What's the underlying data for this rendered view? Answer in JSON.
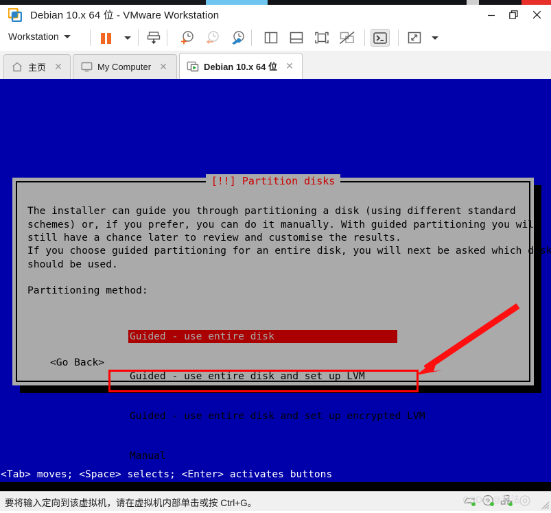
{
  "window": {
    "title": "Debian 10.x 64 位 - VMware Workstation",
    "logo_icon": "vmware-logo-icon",
    "minimize_label": "—",
    "maximize_label": "❐",
    "close_label": "✕"
  },
  "toolbar": {
    "workstation_menu": "Workstation",
    "items": [
      {
        "name": "pause-vm-button",
        "icon": "pause-icon"
      },
      {
        "name": "pause-dropdown-button",
        "icon": "chevron-down-icon"
      },
      {
        "name": "suspend-vm-button",
        "icon": "suspend-save-icon"
      },
      {
        "name": "take-snapshot-button",
        "icon": "snapshot-add-icon"
      },
      {
        "name": "revert-snapshot-button",
        "icon": "snapshot-revert-icon"
      },
      {
        "name": "manage-snapshots-button",
        "icon": "snapshot-manage-icon"
      },
      {
        "name": "show-library-button",
        "icon": "panel-left-icon"
      },
      {
        "name": "show-thumbnail-bar-button",
        "icon": "panel-bottom-icon"
      },
      {
        "name": "full-screen-button",
        "icon": "fullscreen-icon"
      },
      {
        "name": "unity-mode-button",
        "icon": "unity-disabled-icon"
      },
      {
        "name": "console-view-button",
        "icon": "console-prompt-icon"
      },
      {
        "name": "stretch-view-button",
        "icon": "expand-arrows-icon"
      },
      {
        "name": "stretch-dropdown-button",
        "icon": "chevron-down-icon"
      }
    ]
  },
  "tabs": [
    {
      "label": "主页",
      "icon": "home-icon",
      "active": false,
      "close": "✕"
    },
    {
      "label": "My Computer",
      "icon": "monitor-icon",
      "active": false,
      "close": "✕"
    },
    {
      "label": "Debian 10.x 64 位",
      "icon": "vm-running-icon",
      "active": true,
      "close": "✕"
    }
  ],
  "installer": {
    "dialog_title": "[!!] Partition disks",
    "title_color": "#cc0000",
    "paragraph_1": "The installer can guide you through partitioning a disk (using different standard\nschemes) or, if you prefer, you can do it manually. With guided partitioning you will\nstill have a chance later to review and customise the results.",
    "paragraph_2": "If you choose guided partitioning for an entire disk, you will next be asked which disk\nshould be used.",
    "prompt_label": "Partitioning method:",
    "options": [
      "Guided - use entire disk",
      "Guided - use entire disk and set up LVM",
      "Guided - use entire disk and set up encrypted LVM",
      "Manual"
    ],
    "selected_index": 0,
    "selected_bg": "#aa0000",
    "selected_fg": "#aaaaaa",
    "go_back_button": "<Go Back>",
    "key_hint": "<Tab> moves; <Space> selects; <Enter> activates buttons",
    "screen_bg": "#0000aa",
    "dialog_bg": "#aaaaaa"
  },
  "annotations": {
    "highlight_box_color": "#ff0000",
    "arrow_color": "#ff0000",
    "arrow_target": "Guided - use entire disk"
  },
  "statusbar": {
    "message": "要将输入定向到该虚拟机，请在虚拟机内部单击或按 Ctrl+G。",
    "devices": [
      {
        "name": "hard-disk-icon",
        "connected": true
      },
      {
        "name": "cd-dvd-icon",
        "connected": true
      },
      {
        "name": "network-adapter-icon",
        "connected": true
      },
      {
        "name": "sound-card-icon",
        "connected": false
      }
    ],
    "resize_grip": "resize-grip-icon",
    "watermark": "CSDN @利法"
  }
}
